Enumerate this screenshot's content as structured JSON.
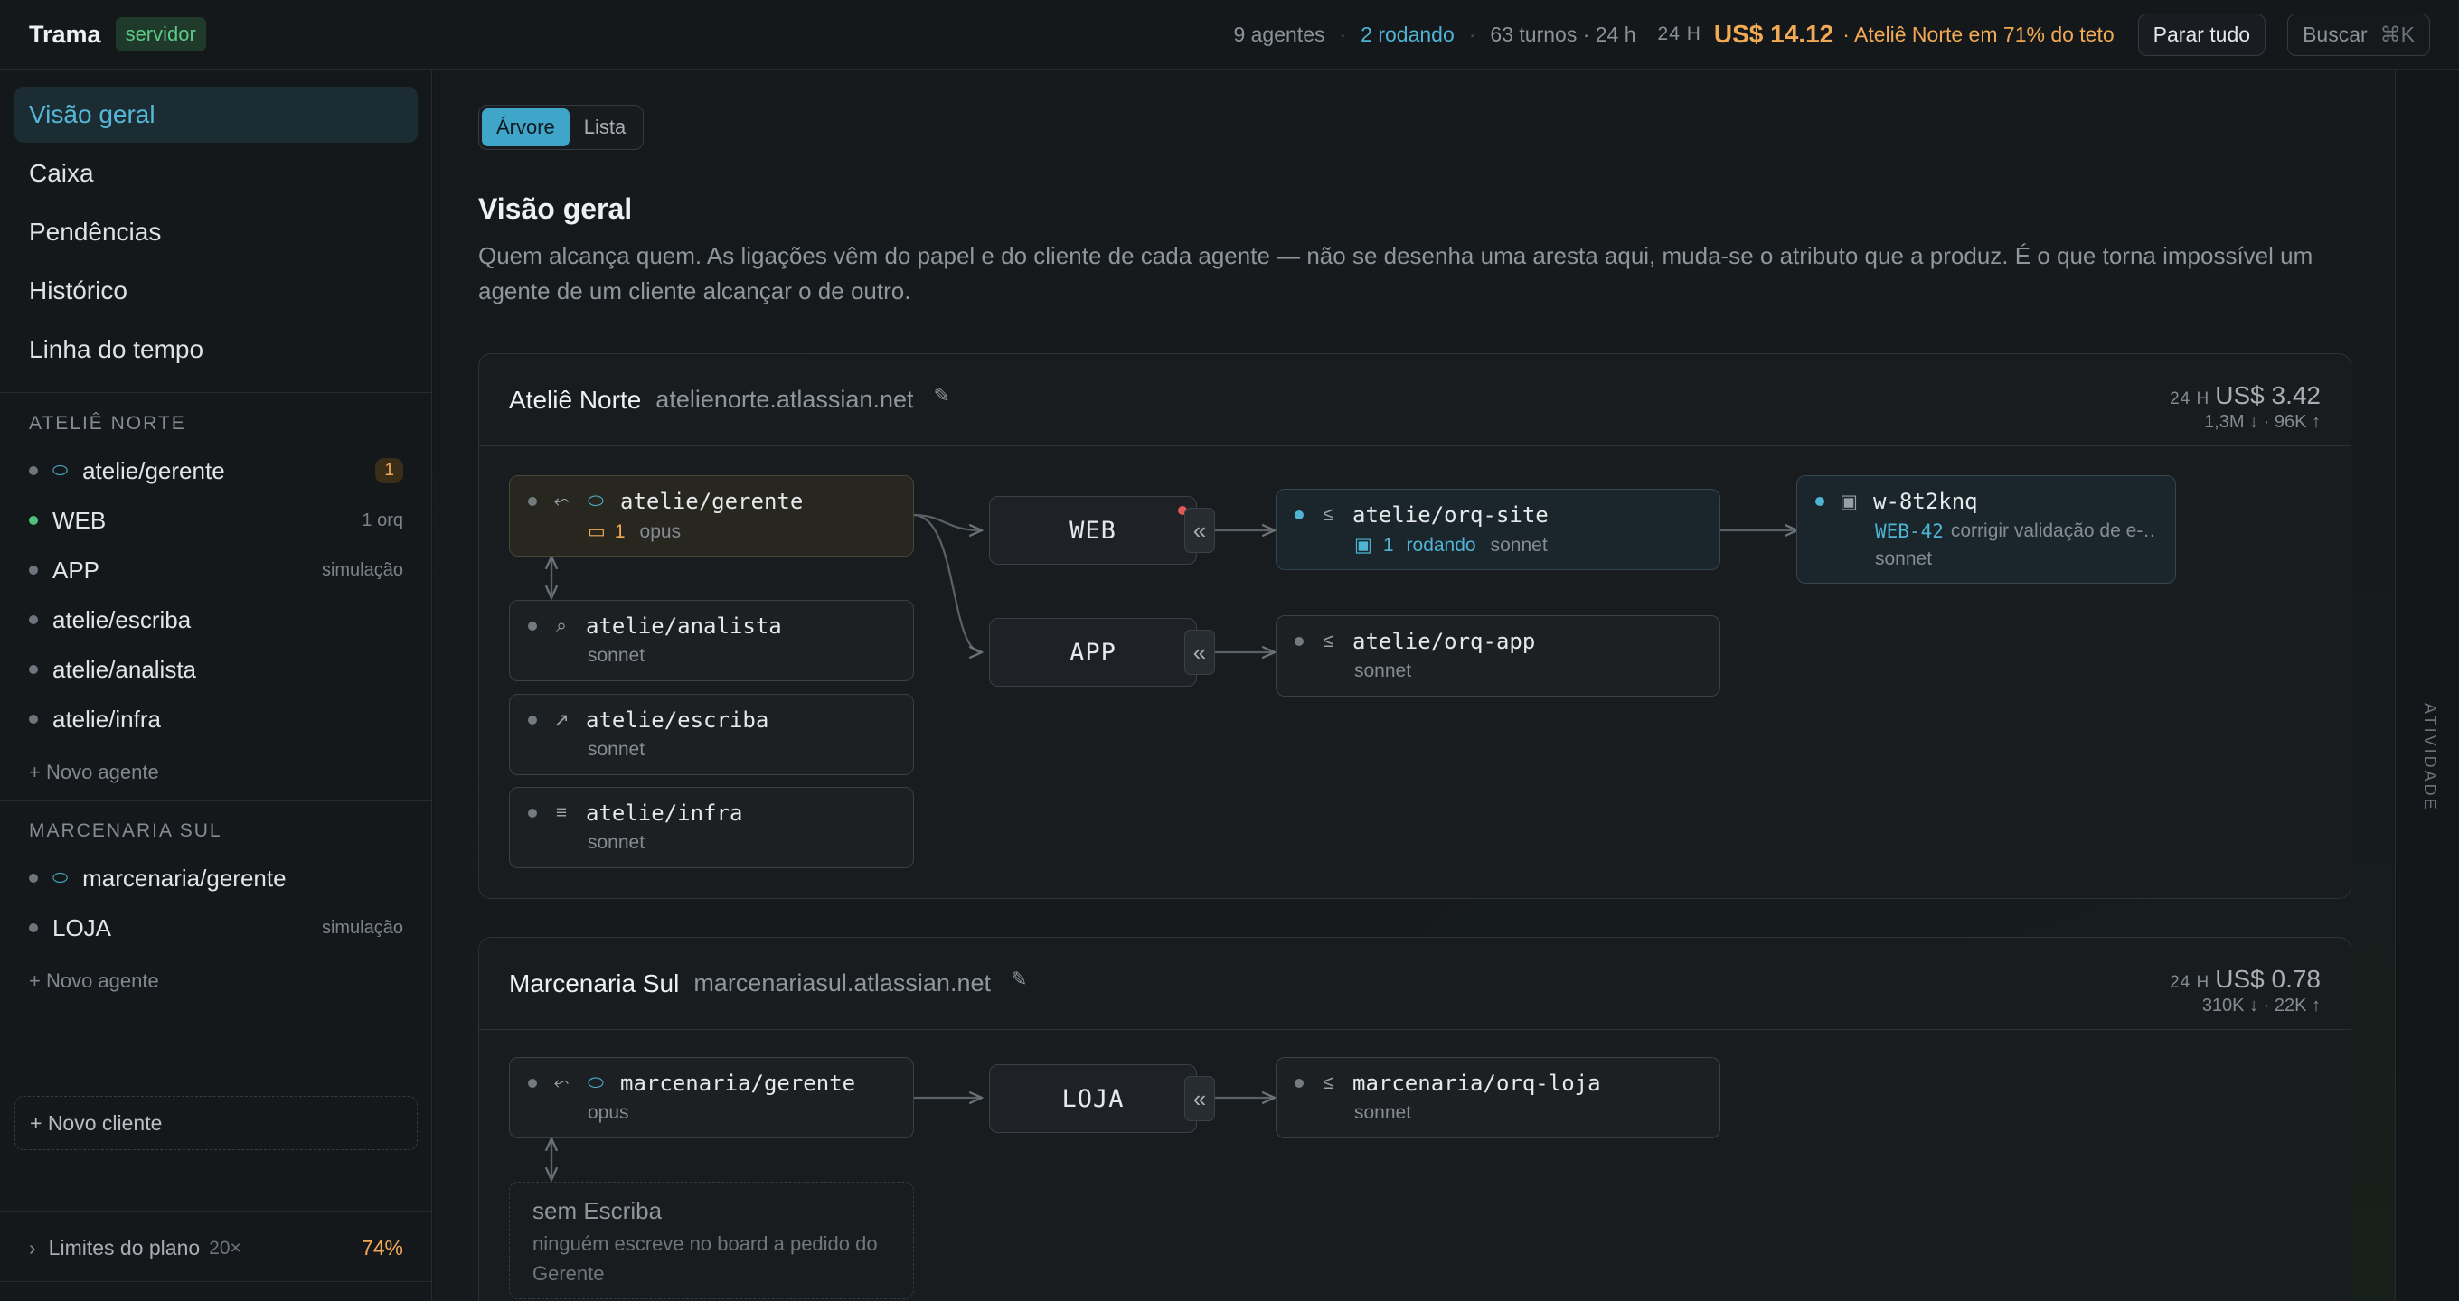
{
  "topbar": {
    "brand": "Trama",
    "badge": "servidor",
    "agents": "9 agentes",
    "running": "2 rodando",
    "turns": "63 turnos · 24 h",
    "period": "24 H",
    "cost": "US$ 14.12",
    "warning": "· Ateliê Norte em 71% do teto",
    "stop_all": "Parar tudo",
    "search": "Buscar",
    "search_kbd": "⌘K"
  },
  "sidebar": {
    "nav": [
      "Visão geral",
      "Caixa",
      "Pendências",
      "Histórico",
      "Linha do tempo"
    ],
    "sections": [
      {
        "title": "ATELIÊ NORTE",
        "items": [
          {
            "label": "atelie/gerente",
            "badge": "1"
          },
          {
            "label": "WEB",
            "meta": "1 orq"
          },
          {
            "label": "APP",
            "meta": "simulação"
          },
          {
            "label": "atelie/escriba"
          },
          {
            "label": "atelie/analista"
          },
          {
            "label": "atelie/infra"
          }
        ],
        "new_agent": "+ Novo agente"
      },
      {
        "title": "MARCENARIA SUL",
        "items": [
          {
            "label": "marcenaria/gerente"
          },
          {
            "label": "LOJA",
            "meta": "simulação"
          }
        ],
        "new_agent": "+ Novo agente"
      }
    ],
    "new_client": "+ Novo cliente",
    "limits_label": "Limites do plano",
    "limits_mult": "20×",
    "limits_pct": "74%"
  },
  "main": {
    "tabs": [
      "Árvore",
      "Lista"
    ],
    "title": "Visão geral",
    "description": "Quem alcança quem. As ligações vêm do papel e do cliente de cada agente — não se desenha uma aresta aqui, muda-se o atributo que a produz. É o que torna impossível um agente de um cliente alcançar o de outro."
  },
  "clients": [
    {
      "name": "Ateliê Norte",
      "domain": "atelienorte.atlassian.net",
      "period": "24 H",
      "cost": "US$ 3.42",
      "tokens": "1,3M ↓ · 96K ↑",
      "nodes": {
        "gerente": {
          "name": "atelie/gerente",
          "inbox": "1",
          "model": "opus"
        },
        "analista": {
          "name": "atelie/analista",
          "model": "sonnet"
        },
        "escriba": {
          "name": "atelie/escriba",
          "model": "sonnet"
        },
        "infra": {
          "name": "atelie/infra",
          "model": "sonnet"
        },
        "web": "WEB",
        "app": "APP",
        "orq_site": {
          "name": "atelie/orq-site",
          "count": "1",
          "status": "rodando",
          "model": "sonnet"
        },
        "orq_app": {
          "name": "atelie/orq-app",
          "model": "sonnet"
        },
        "worker": {
          "name": "w-8t2knq",
          "ticket": "WEB-42",
          "task": "corrigir validação de e-…",
          "model": "sonnet"
        }
      }
    },
    {
      "name": "Marcenaria Sul",
      "domain": "marcenariasul.atlassian.net",
      "period": "24 H",
      "cost": "US$ 0.78",
      "tokens": "310K ↓ · 22K ↑",
      "nodes": {
        "gerente": {
          "name": "marcenaria/gerente",
          "model": "opus"
        },
        "loja": "LOJA",
        "orq_loja": {
          "name": "marcenaria/orq-loja",
          "model": "sonnet"
        },
        "no_scribe_title": "sem Escriba",
        "no_scribe_desc": "ninguém escreve no board a pedido do Gerente"
      }
    }
  ],
  "rightbar": {
    "label": "ATIVIDADE"
  },
  "colors": {
    "accent": "#4fb3d3",
    "warning": "#f0a954",
    "success": "#4ec27d",
    "alert": "#e05a5a"
  }
}
